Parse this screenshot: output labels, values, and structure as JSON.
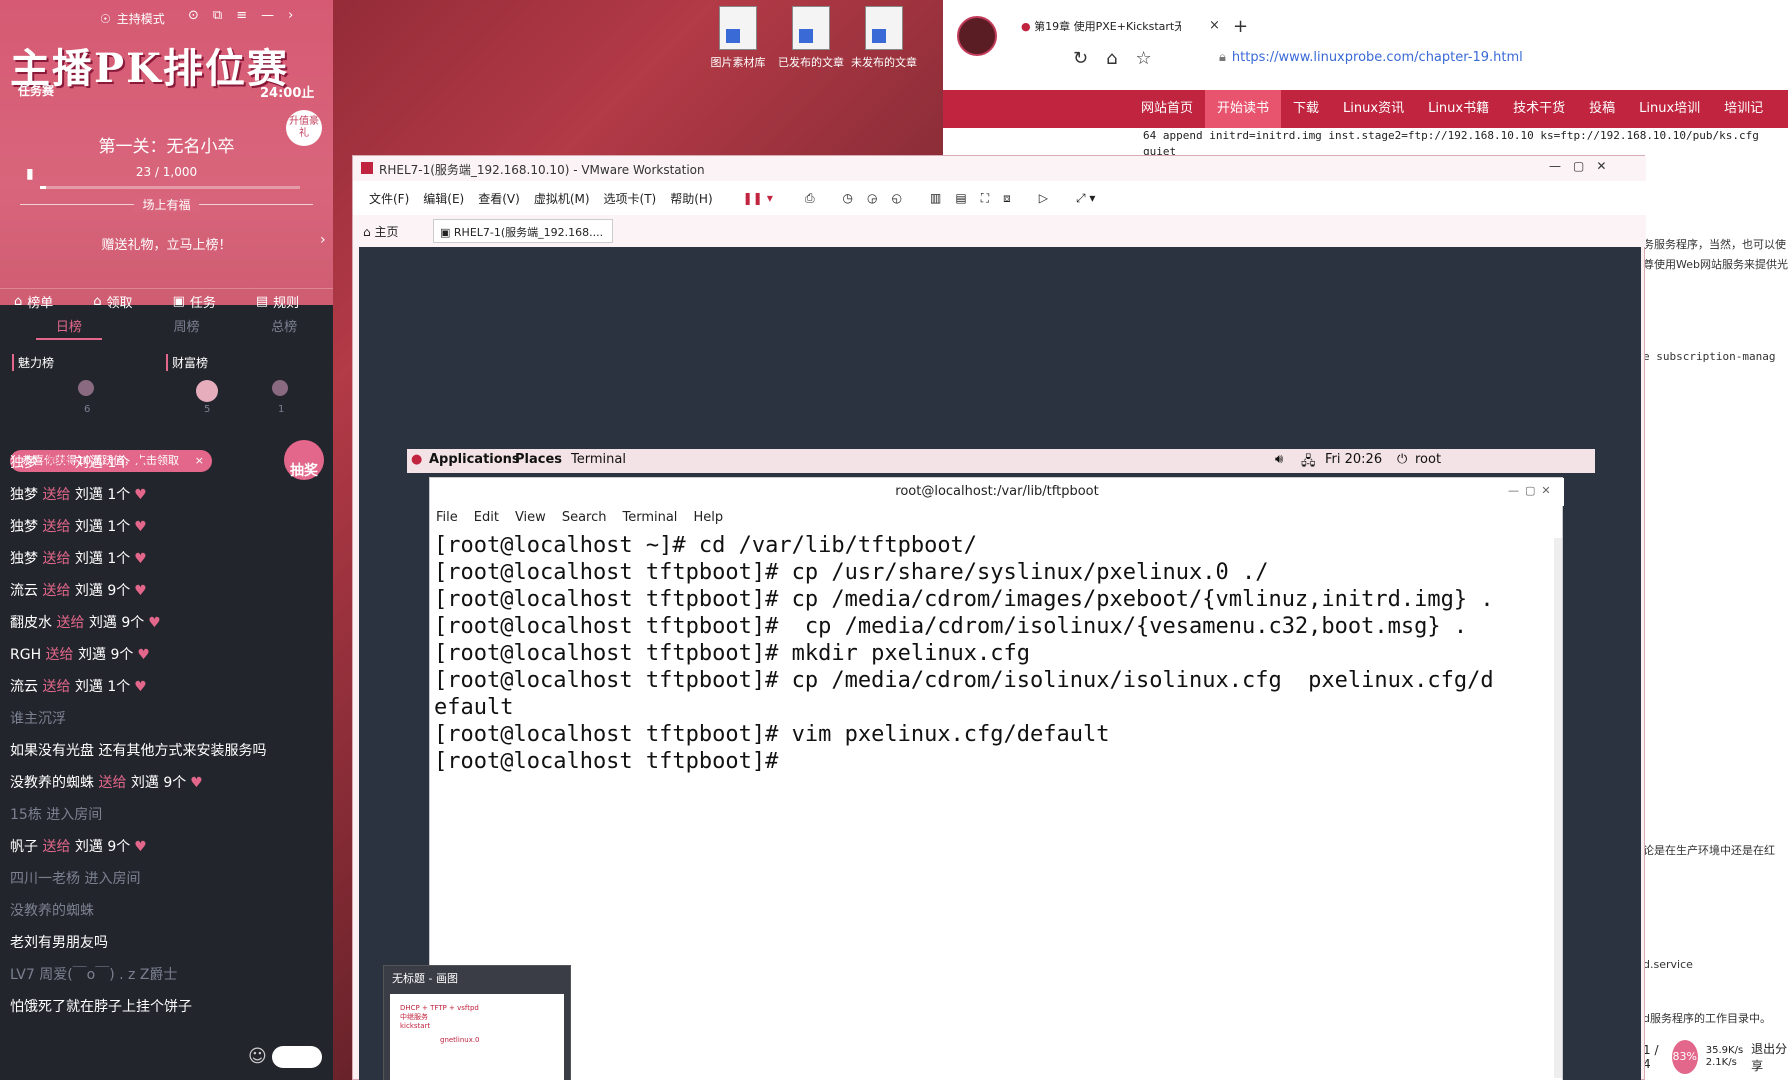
{
  "desktop": {
    "icons": [
      {
        "label": "图片素材库"
      },
      {
        "label": "已发布的文章"
      },
      {
        "label": "未发布的文章"
      }
    ]
  },
  "sidebar": {
    "mode_label": "主持模式",
    "pk_banner": "主播PK排位赛",
    "task_label": "任务赛",
    "countdown": "24:00止",
    "badge_text": "升值豪礼",
    "stage_title": "第一关：无名小卒",
    "progress_text": "23 / 1,000",
    "progress_value": 0.023,
    "onstage_label": "场上有福",
    "gift_cta": "赠送礼物，立马上榜！",
    "tabs": [
      {
        "label": "榜单"
      },
      {
        "label": "领取"
      },
      {
        "label": "任务"
      },
      {
        "label": "规则"
      }
    ],
    "rank_tabs": [
      {
        "label": "日榜"
      },
      {
        "label": "周榜"
      },
      {
        "label": "总榜"
      }
    ],
    "rank_labels": [
      "魅力榜",
      "财富榜"
    ],
    "rank_counts": [
      "6",
      "5",
      "1"
    ],
    "toast": "恭喜你获得10活跃值，点击领取",
    "lottery_label": "抽奖",
    "chat": [
      {
        "user": "独梦",
        "action": "送给",
        "target": "刘邁 1个"
      },
      {
        "user": "独梦",
        "action": "送给",
        "target": "刘邁 1个"
      },
      {
        "user": "独梦",
        "action": "送给",
        "target": "刘邁 1个"
      },
      {
        "user": "独梦",
        "action": "送给",
        "target": "刘邁 1个"
      },
      {
        "user": "流云",
        "action": "送给",
        "target": "刘邁 9个"
      },
      {
        "user": "翻皮水",
        "action": "送给",
        "target": "刘邁 9个"
      },
      {
        "user": "RGH",
        "action": "送给",
        "target": "刘邁 9个"
      },
      {
        "user": "流云",
        "action": "送给",
        "target": "刘邁 1个"
      },
      {
        "user": "谁主沉浮",
        "action": "",
        "target": ""
      },
      {
        "user": "",
        "action": "",
        "target": "如果没有光盘   还有其他方式来安装服务吗"
      },
      {
        "user": "没教养的蜘蛛",
        "action": "送给",
        "target": "刘邁 9个"
      },
      {
        "user": "",
        "action": "",
        "target": "15栋 进入房间"
      },
      {
        "user": "帆子",
        "action": "送给",
        "target": "刘邁 9个"
      },
      {
        "user": "",
        "action": "",
        "target": "四川一老杨 进入房间"
      },
      {
        "user": "没教养的蜘蛛",
        "action": "",
        "target": ""
      },
      {
        "user": "",
        "action": "",
        "target": "老刘有男朋友吗"
      },
      {
        "user": "LV7 周爱(￣o￣) . z Z爵士",
        "action": "",
        "target": ""
      },
      {
        "user": "",
        "action": "",
        "target": "怕饿死了就在脖子上挂个饼子"
      }
    ]
  },
  "browser": {
    "tab_title": "第19章 使用PXE+Kickstart无…",
    "url": "https://www.linuxprobe.com/chapter-19.html",
    "nav": [
      "网站首页",
      "开始读书",
      "下载",
      "Linux资讯",
      "Linux书籍",
      "技术干货",
      "投稿",
      "Linux培训",
      "培训记"
    ],
    "code_line": "64 append initrd=initrd.img inst.stage2=ftp://192.168.10.10 ks=ftp://192.168.10.10/pub/ks.cfg quiet",
    "side_text": [
      "务服务程序，当然，也可以使",
      "尊使用Web网站服务来提供光",
      "e subscription-manag",
      "论是在生产环境中还是在红",
      "d.service",
      "d服务程序的工作目录中。"
    ],
    "page_indicator": "1 / 4",
    "net_up": "35.9K/s",
    "net_down": "2.1K/s",
    "cpu_percent": "83%",
    "share_exit": "退出分享"
  },
  "vmware": {
    "title": "RHEL7-1(服务端_192.168.10.10) - VMware Workstation",
    "menu": [
      "文件(F)",
      "编辑(E)",
      "查看(V)",
      "虚拟机(M)",
      "选项卡(T)",
      "帮助(H)"
    ],
    "tabs": [
      "主页",
      "RHEL7-1(服务端_192.168...."
    ],
    "gnome": {
      "applications": "Applications",
      "places": "Places",
      "terminal": "Terminal",
      "clock": "Fri 20:26",
      "user": "root"
    },
    "terminal": {
      "title": "root@localhost:/var/lib/tftpboot",
      "menu": [
        "File",
        "Edit",
        "View",
        "Search",
        "Terminal",
        "Help"
      ],
      "lines": [
        "[root@localhost ~]# cd /var/lib/tftpboot/",
        "[root@localhost tftpboot]# cp /usr/share/syslinux/pxelinux.0 ./",
        "[root@localhost tftpboot]# cp /media/cdrom/images/pxeboot/{vmlinuz,initrd.img} .",
        "[root@localhost tftpboot]#  cp /media/cdrom/isolinux/{vesamenu.c32,boot.msg} .",
        "[root@localhost tftpboot]# mkdir pxelinux.cfg",
        "[root@localhost tftpboot]# cp /media/cdrom/isolinux/isolinux.cfg  pxelinux.cfg/d",
        "efault",
        "[root@localhost tftpboot]# vim pxelinux.cfg/default",
        "[root@localhost tftpboot]# "
      ]
    },
    "thumb_title": "无标题 - 画图",
    "thumb_text": [
      "DHCP + TFTP + vsftpd",
      "中继服务",
      "kickstart",
      "gnetlinux.0"
    ]
  }
}
